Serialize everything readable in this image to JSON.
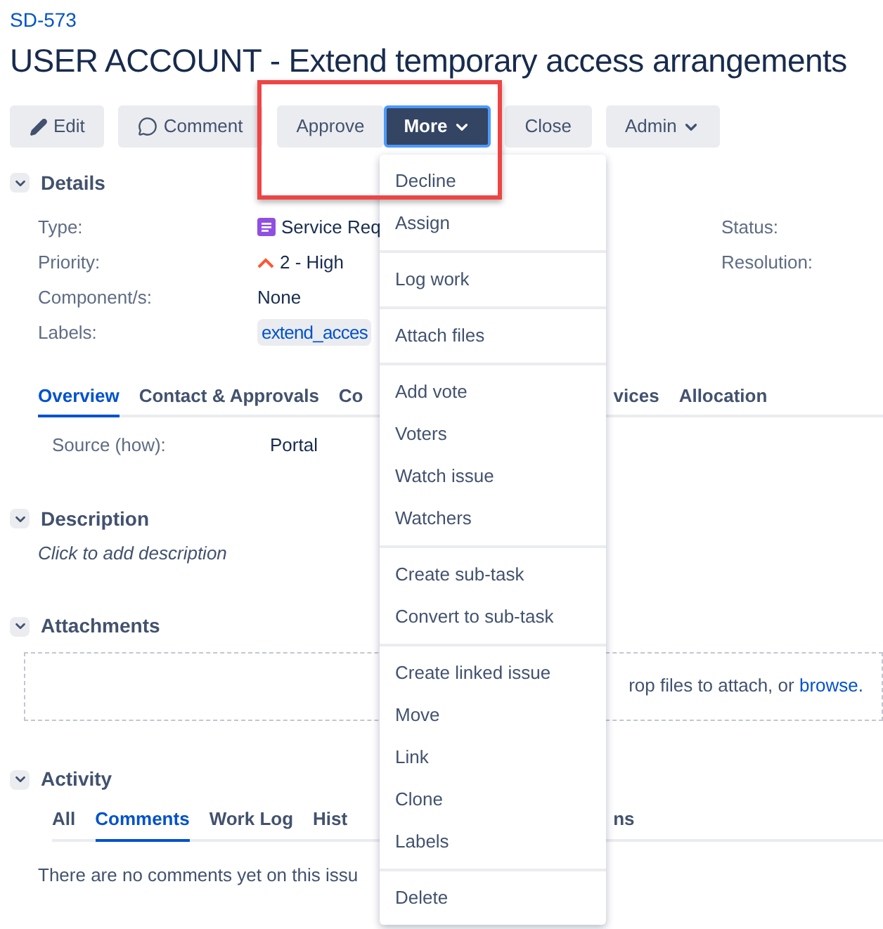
{
  "issue_key": "SD-573",
  "title": "USER ACCOUNT - Extend temporary access arrangements",
  "buttons": [
    {
      "label": "Edit",
      "kind": "edit",
      "caret": false,
      "active": false
    },
    {
      "label": "Comment",
      "kind": "comment",
      "caret": false,
      "active": false
    },
    {
      "label": "Approve",
      "kind": "plain",
      "caret": false,
      "active": false
    },
    {
      "label": "More",
      "kind": "plain",
      "caret": true,
      "active": true
    },
    {
      "label": "Close",
      "kind": "plain",
      "caret": false,
      "active": false
    },
    {
      "label": "Admin",
      "kind": "plain",
      "caret": true,
      "active": false
    }
  ],
  "details": {
    "heading": "Details",
    "expanded": true,
    "left": [
      {
        "label": "Type:",
        "value": "Service Req",
        "kind": "type"
      },
      {
        "label": "Priority:",
        "value": "2 - High",
        "kind": "priority"
      },
      {
        "label": "Component/s:",
        "value": "None",
        "kind": "text"
      },
      {
        "label": "Labels:",
        "value": "extend_acces",
        "kind": "tag"
      }
    ],
    "right": [
      {
        "label": "Status:"
      },
      {
        "label": "Resolution:"
      }
    ]
  },
  "tabs": [
    {
      "label": "Overview",
      "selected": true
    },
    {
      "label": "Contact & Approvals",
      "selected": false
    },
    {
      "label": "Co",
      "selected": false
    },
    {
      "label": "vices",
      "selected": false
    },
    {
      "label": "Allocation",
      "selected": false
    }
  ],
  "overview_fields": [
    {
      "label": "Source (how):",
      "value": "Portal"
    }
  ],
  "description": {
    "heading": "Description",
    "expanded": true,
    "placeholder": "Click to add description"
  },
  "attachments": {
    "heading": "Attachments",
    "expanded": true,
    "drop_text": "rop files to attach, or ",
    "browse_link": "browse."
  },
  "activity": {
    "heading": "Activity",
    "expanded": true,
    "tabs": [
      {
        "label": "All",
        "selected": false
      },
      {
        "label": "Comments",
        "selected": true
      },
      {
        "label": "Work Log",
        "selected": false
      },
      {
        "label": "Hist",
        "selected": false
      },
      {
        "label": "ns",
        "selected": false
      }
    ],
    "empty_text": "There are no comments yet on this issu"
  },
  "more_menu": {
    "groups": [
      {
        "items": [
          "Decline",
          "Assign"
        ]
      },
      {
        "items": [
          "Log work"
        ]
      },
      {
        "items": [
          "Attach files"
        ]
      },
      {
        "items": [
          "Add vote",
          "Voters",
          "Watch issue",
          "Watchers"
        ]
      },
      {
        "items": [
          "Create sub-task",
          "Convert to sub-task"
        ]
      },
      {
        "items": [
          "Create linked issue",
          "Move",
          "Link",
          "Clone",
          "Labels"
        ]
      },
      {
        "items": [
          "Delete"
        ]
      }
    ]
  },
  "highlight": {
    "visible": true
  }
}
